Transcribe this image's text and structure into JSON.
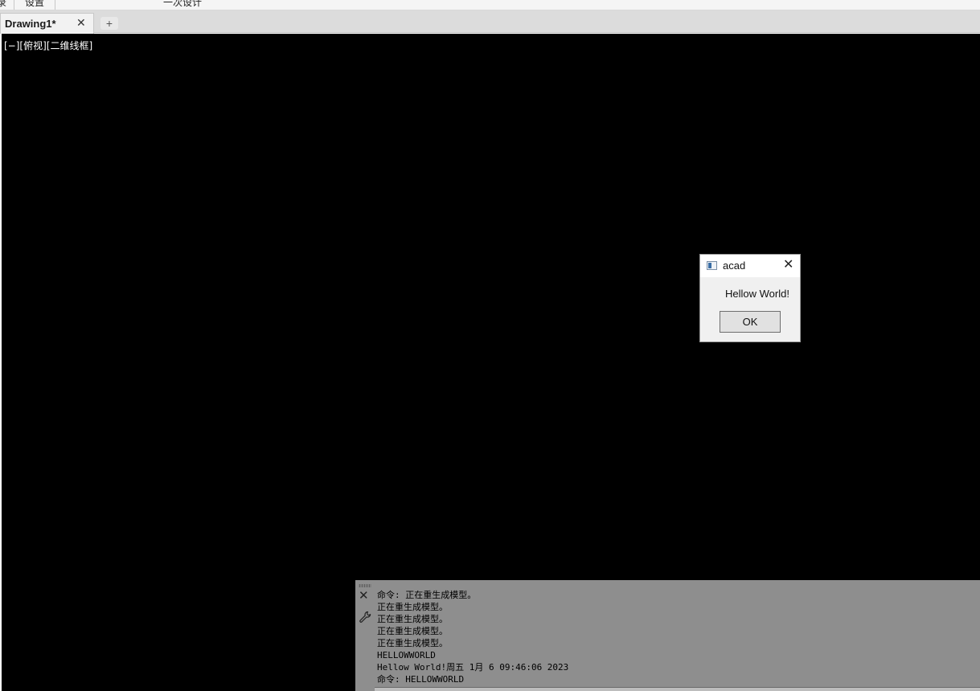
{
  "ribbon": {
    "items": [
      {
        "label": "录"
      },
      {
        "label": "设置"
      },
      {
        "label": "一次设计"
      }
    ]
  },
  "tabs": {
    "active_label": "Drawing1*",
    "close_glyph": "✕",
    "new_tab_glyph": "+"
  },
  "viewport": {
    "label": "[−][俯视][二维线框]"
  },
  "dialog": {
    "title": "acad",
    "close_glyph": "✕",
    "message": "Hellow World!",
    "ok_label": "OK"
  },
  "command_panel": {
    "close_glyph": "✕",
    "icons": [
      "gripper-icon",
      "close-icon",
      "wrench-icon"
    ],
    "history": [
      "命令: 正在重生成模型。",
      "正在重生成模型。",
      "正在重生成模型。",
      "正在重生成模型。",
      "正在重生成模型。",
      "HELLOWWORLD",
      "Hellow World!周五 1月 6 09:46:06 2023",
      "命令: HELLOWWORLD"
    ]
  },
  "colors": {
    "canvas": "#000000",
    "command_panel": "#8e8e8e",
    "dialog_body": "#f0f0f0"
  }
}
